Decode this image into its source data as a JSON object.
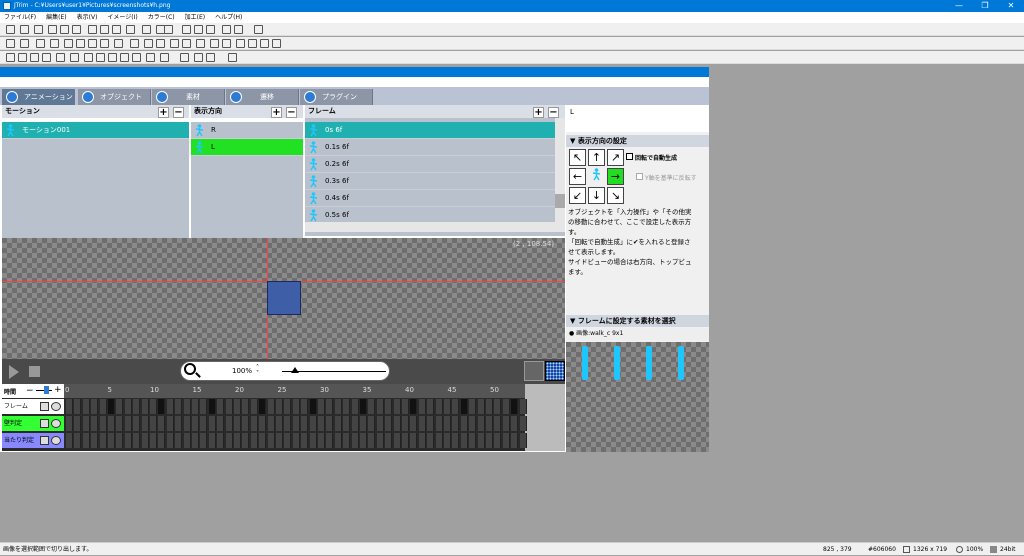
{
  "window": {
    "title": "JTrim - C:¥Users¥user1¥Pictures¥screenshots¥h.png",
    "min": "—",
    "max": "❐",
    "close": "✕"
  },
  "menu": [
    "ファイル(F)",
    "編集(E)",
    "表示(V)",
    "イメージ(I)",
    "カラー(C)",
    "加工(E)",
    "ヘルプ(H)"
  ],
  "tabs": [
    {
      "label": "アニメーション"
    },
    {
      "label": "オブジェクト"
    },
    {
      "label": "素材"
    },
    {
      "label": "遷移"
    },
    {
      "label": "プラグイン"
    }
  ],
  "motion": {
    "header": "モーション",
    "items": [
      "モーション001"
    ]
  },
  "direction": {
    "header": "表示方向",
    "items": [
      "R",
      "L"
    ]
  },
  "frame": {
    "header": "フレーム",
    "items": [
      "0s 6f",
      "0.1s 6f",
      "0.2s 6f",
      "0.3s 6f",
      "0.4s 6f",
      "0.5s 6f"
    ]
  },
  "right": {
    "title": "L",
    "section1": "表示方向の設定",
    "auto_check": "回転で自動生成",
    "flip_check": "Y軸を基準に反転す",
    "desc": "オブジェクトを「入力操作」や「その他実\nの移動に合わせて、ここで設定した表示方\nす。\n「回転で自動生成」に✔を入れると登録さ\nせて表示します。\nサイドビューの場合は右方向、トップビュ\nます。",
    "section2": "フレームに設定する素材を選択",
    "asset": "画像:walk_c 9x1"
  },
  "canvas": {
    "coord": "(2 , 108.54)",
    "zoom": "100%"
  },
  "timeline": {
    "time_label": "時間",
    "rows": [
      "フレーム",
      "壁判定",
      "当たり判定"
    ],
    "ticks": [
      "0",
      "5",
      "10",
      "15",
      "20",
      "25",
      "30",
      "35",
      "40",
      "45",
      "50"
    ],
    "row_colors": [
      "#ffffff",
      "#33ff33",
      "#8888ff"
    ]
  },
  "status": {
    "message": "画像を選択範囲で切り出します。",
    "cursor": "825 , 379",
    "color": "#606060",
    "size": "1326 x 719",
    "zoom": "100%",
    "bits": "24bit"
  }
}
